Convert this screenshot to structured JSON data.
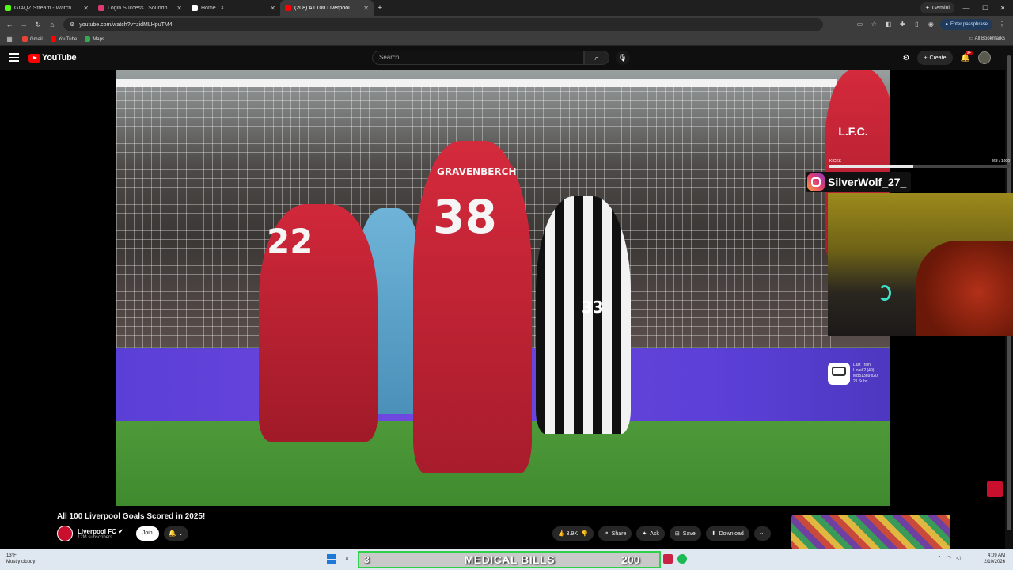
{
  "browser": {
    "tabs": [
      {
        "title": "GIAQZ Stream - Watch Live",
        "color": "#53fc18",
        "active": false
      },
      {
        "title": "Login Success | Soundboard Bot",
        "color": "#e03a76",
        "active": false
      },
      {
        "title": "Home / X",
        "color": "#ffffff",
        "active": false
      },
      {
        "title": "(208) All 100 Liverpool Goals",
        "color": "#ff0000",
        "active": true
      }
    ],
    "gemini_label": "Gemini",
    "url": "youtube.com/watch?v=zidMLHpuTM4",
    "passphrase_label": "Enter passphrase",
    "bookmarks": [
      {
        "label": "Gmail",
        "color": "#ea4335"
      },
      {
        "label": "YouTube",
        "color": "#ff0000"
      },
      {
        "label": "Maps",
        "color": "#34a853"
      }
    ],
    "all_bookmarks_label": "All Bookmarks"
  },
  "youtube": {
    "logo_text": "YouTube",
    "search_placeholder": "Search",
    "create_label": "Create",
    "notif_badge": "9+"
  },
  "video": {
    "jersey_22": "22",
    "jersey_38": "38",
    "jersey_name": "GRAVENBERCH",
    "crest_text": "L.F.C.",
    "opponent_number": "33"
  },
  "overlays": {
    "kicks_label": "KICKS",
    "kicks_count": "463 / 1000",
    "kicks_progress": 0.463,
    "instagram_handle": "SilverWolf_27_",
    "train_line1": "Last Train",
    "train_line2": "Level 2 (49)",
    "train_line3": "MB51389 x20",
    "train_line4": "21 Subs"
  },
  "info": {
    "title": "All 100 Liverpool Goals Scored in 2025!",
    "channel_name": "Liverpool FC",
    "subscribers": "12M subscribers",
    "join_label": "Join",
    "likes": "3.9K",
    "share_label": "Share",
    "ask_label": "Ask",
    "save_label": "Save",
    "download_label": "Download"
  },
  "taskbar": {
    "weather_temp": "13°F",
    "weather_desc": "Mostly cloudy",
    "banner_number": "3",
    "banner_text": "MEDICAL BILLS",
    "banner_count": "200",
    "time": "4:09 AM",
    "date": "2/10/2026"
  }
}
